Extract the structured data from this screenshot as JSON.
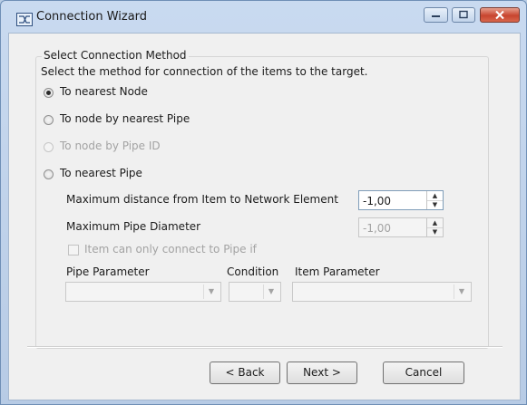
{
  "window": {
    "title": "Connection Wizard",
    "icon": "connection-wizard-icon"
  },
  "group": {
    "title": "Select Connection Method",
    "description": "Select the method for connection of the items to the target."
  },
  "radios": [
    {
      "label": "To nearest Node",
      "selected": true,
      "enabled": true
    },
    {
      "label": "To node by nearest Pipe",
      "selected": false,
      "enabled": true
    },
    {
      "label": "To node by Pipe ID",
      "selected": false,
      "enabled": false
    },
    {
      "label": "To nearest Pipe",
      "selected": false,
      "enabled": true
    }
  ],
  "max_distance": {
    "label": "Maximum distance from Item to Network Element",
    "value": "-1,00"
  },
  "max_diameter": {
    "label": "Maximum Pipe Diameter",
    "value": "-1,00"
  },
  "checkbox": {
    "label": "Item can only connect to Pipe if",
    "checked": false
  },
  "filter": {
    "pipe_parameter_label": "Pipe Parameter",
    "condition_label": "Condition",
    "item_parameter_label": "Item Parameter"
  },
  "buttons": {
    "back": "< Back",
    "next": "Next >",
    "cancel": "Cancel"
  }
}
